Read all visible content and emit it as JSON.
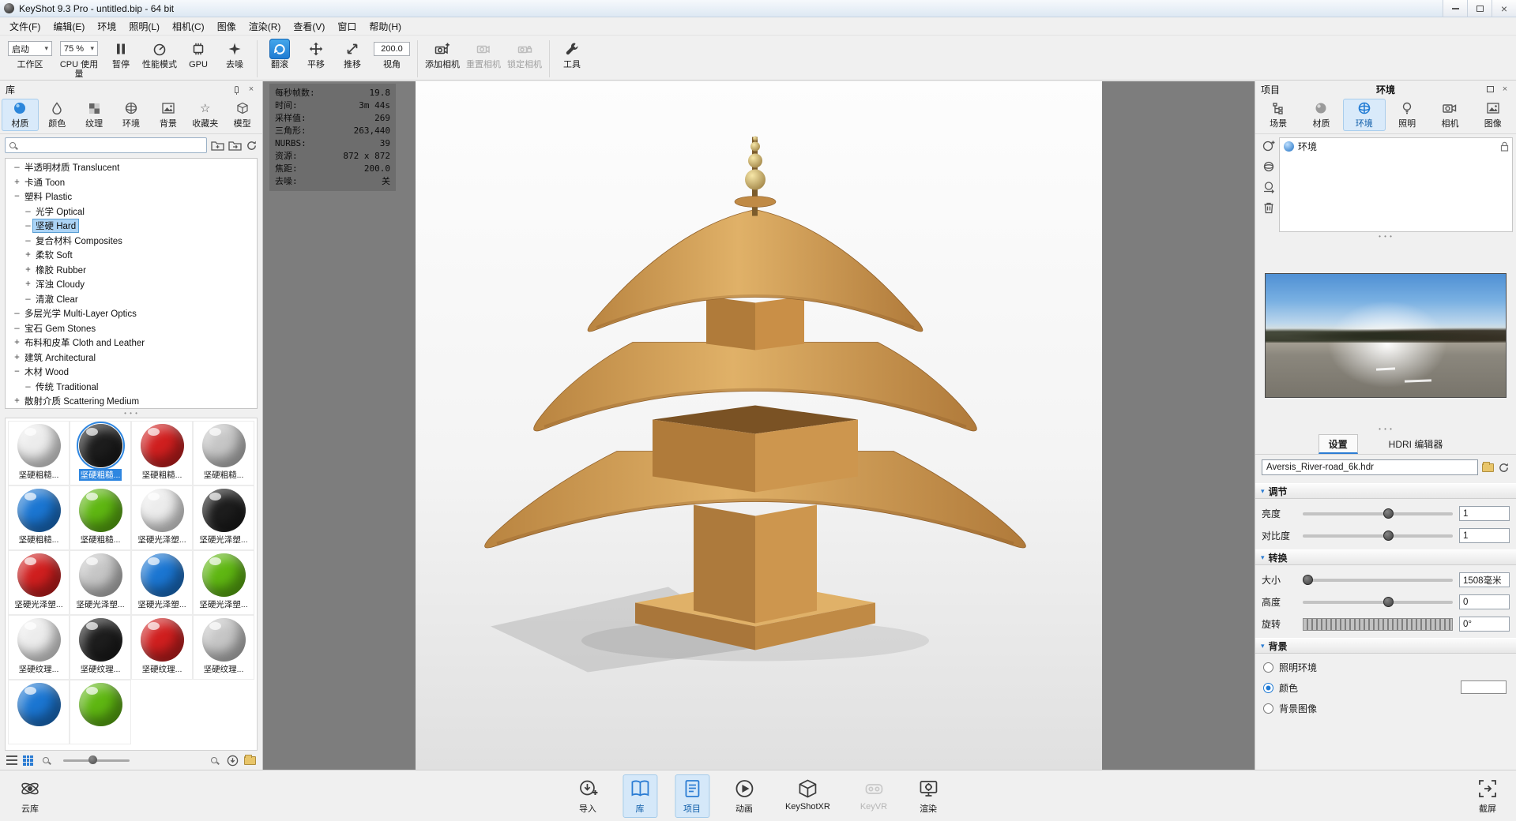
{
  "window": {
    "title": "KeyShot 9.3 Pro  - untitled.bip  - 64 bit"
  },
  "icons": {
    "chevron_down": "▾",
    "star": "☆"
  },
  "menubar": {
    "items": [
      "文件(F)",
      "编辑(E)",
      "环境",
      "照明(L)",
      "相机(C)",
      "图像",
      "渲染(R)",
      "查看(V)",
      "窗口",
      "帮助(H)"
    ]
  },
  "toolbar": {
    "workspace": {
      "value": "启动",
      "label": "工作区"
    },
    "cpu": {
      "value": "75 %",
      "label": "CPU 使用量"
    },
    "pause": {
      "label": "暂停"
    },
    "performance": {
      "label": "性能模式"
    },
    "gpu": {
      "label": "GPU"
    },
    "denoise": {
      "label": "去噪"
    },
    "tumble": {
      "label": "翻滚"
    },
    "pan": {
      "label": "平移"
    },
    "dolly": {
      "label": "推移"
    },
    "fov": {
      "value": "200.0",
      "label": "视角"
    },
    "add_camera": {
      "label": "添加相机"
    },
    "reset_camera": {
      "label": "重置相机"
    },
    "lock_camera": {
      "label": "锁定相机"
    },
    "tools": {
      "label": "工具"
    }
  },
  "stats": {
    "rows": [
      {
        "label": "每秒帧数:",
        "value": "19.8"
      },
      {
        "label": "时间:",
        "value": "3m 44s"
      },
      {
        "label": "采样值:",
        "value": "269"
      },
      {
        "label": "三角形:",
        "value": "263,440"
      },
      {
        "label": "NURBS:",
        "value": "39"
      },
      {
        "label": "资源:",
        "value": "872 x 872"
      },
      {
        "label": "焦距:",
        "value": "200.0"
      },
      {
        "label": "去噪:",
        "value": "关"
      }
    ]
  },
  "library": {
    "title": "库",
    "tabs": [
      {
        "label": "材质"
      },
      {
        "label": "颜色"
      },
      {
        "label": "纹理"
      },
      {
        "label": "环境"
      },
      {
        "label": "背景"
      },
      {
        "label": "收藏夹"
      },
      {
        "label": "模型"
      }
    ],
    "tree": [
      {
        "exp": "–",
        "label": "半透明材质 Translucent"
      },
      {
        "exp": "+",
        "label": "卡通 Toon"
      },
      {
        "exp": "−",
        "label": "塑料 Plastic"
      },
      {
        "exp": "–",
        "label": "光学 Optical"
      },
      {
        "exp": "–",
        "label": "坚硬 Hard"
      },
      {
        "exp": "–",
        "label": "复合材料 Composites"
      },
      {
        "exp": "+",
        "label": "柔软 Soft"
      },
      {
        "exp": "+",
        "label": "橡胶 Rubber"
      },
      {
        "exp": "+",
        "label": "浑浊 Cloudy"
      },
      {
        "exp": "–",
        "label": "清澈 Clear"
      },
      {
        "exp": "–",
        "label": "多层光学 Multi-Layer Optics"
      },
      {
        "exp": "–",
        "label": "宝石 Gem Stones"
      },
      {
        "exp": "+",
        "label": "布料和皮革 Cloth and Leather"
      },
      {
        "exp": "+",
        "label": "建筑 Architectural"
      },
      {
        "exp": "−",
        "label": "木材 Wood"
      },
      {
        "exp": "–",
        "label": "传统 Traditional"
      },
      {
        "exp": "+",
        "label": "散射介质 Scattering Medium"
      }
    ],
    "materials": [
      {
        "label": "坚硬粗糙...",
        "color": "#ececec"
      },
      {
        "label": "坚硬粗糙...",
        "color": "#1d1d1d"
      },
      {
        "label": "坚硬粗糙...",
        "color": "#d01f1f"
      },
      {
        "label": "坚硬粗糙...",
        "color": "#c6c6c6"
      },
      {
        "label": "坚硬粗糙...",
        "color": "#1b76d2"
      },
      {
        "label": "坚硬粗糙...",
        "color": "#5fb712"
      },
      {
        "label": "坚硬光泽塑...",
        "color": "#ececec"
      },
      {
        "label": "坚硬光泽塑...",
        "color": "#1d1d1d"
      },
      {
        "label": "坚硬光泽塑...",
        "color": "#d01f1f"
      },
      {
        "label": "坚硬光泽塑...",
        "color": "#c6c6c6"
      },
      {
        "label": "坚硬光泽塑...",
        "color": "#1b76d2"
      },
      {
        "label": "坚硬光泽塑...",
        "color": "#5fb712"
      },
      {
        "label": "坚硬纹理...",
        "color": "#ececec"
      },
      {
        "label": "坚硬纹理...",
        "color": "#1d1d1d"
      },
      {
        "label": "坚硬纹理...",
        "color": "#d01f1f"
      },
      {
        "label": "坚硬纹理...",
        "color": "#c6c6c6"
      },
      {
        "label": "",
        "color": "#1b76d2"
      },
      {
        "label": "",
        "color": "#5fb712"
      }
    ]
  },
  "project": {
    "title": "项目",
    "page_title": "环境",
    "tabs": [
      {
        "label": "场景"
      },
      {
        "label": "材质"
      },
      {
        "label": "环境"
      },
      {
        "label": "照明"
      },
      {
        "label": "相机"
      },
      {
        "label": "图像"
      }
    ],
    "environment_item": "环境",
    "settings_tabs": {
      "settings": "设置",
      "hdri_editor": "HDRI 编辑器"
    },
    "hdr_file": "Aversis_River-road_6k.hdr",
    "sections": {
      "adjust": {
        "title": "调节",
        "brightness_label": "亮度",
        "brightness_value": "1",
        "contrast_label": "对比度",
        "contrast_value": "1"
      },
      "transform": {
        "title": "转换",
        "size_label": "大小",
        "size_value": "1508毫米",
        "height_label": "高度",
        "height_value": "0",
        "rotation_label": "旋转",
        "rotation_value": "0°"
      },
      "background": {
        "title": "背景",
        "options": [
          {
            "label": "照明环境"
          },
          {
            "label": "颜色"
          },
          {
            "label": "背景图像"
          }
        ]
      }
    }
  },
  "bottombar": {
    "cloud": "云库",
    "items": [
      {
        "label": "导入"
      },
      {
        "label": "库"
      },
      {
        "label": "项目"
      },
      {
        "label": "动画"
      },
      {
        "label": "KeyShotXR"
      },
      {
        "label": "KeyVR"
      },
      {
        "label": "渲染"
      }
    ],
    "capture": "截屏"
  },
  "colors": {
    "accent": "#2b7cd3",
    "selection_fill": "#abd3f5",
    "viewport_bg": "#7d7d7d",
    "wood": "#c89049"
  }
}
